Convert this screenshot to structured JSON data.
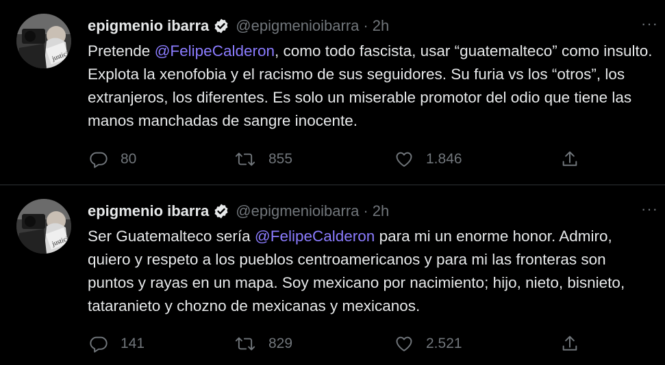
{
  "tweets": [
    {
      "author_name": "epigmenio ibarra",
      "author_handle": "@epigmenioibarra",
      "time": "2h",
      "text_before": "Pretende ",
      "mention": "@FelipeCalderon",
      "text_after": ", como todo fascista, usar “guatemalteco” como insulto. Explota la xenofobia y el racismo de sus seguidores. Su furia vs los “otros”, los extranjeros, los diferentes. Es solo un miserable promotor del odio que tiene las manos manchadas de sangre inocente.",
      "replies": "80",
      "retweets": "855",
      "likes": "1.846",
      "avatar_caption": "justicia"
    },
    {
      "author_name": "epigmenio ibarra",
      "author_handle": "@epigmenioibarra",
      "time": "2h",
      "text_before": "Ser Guatemalteco sería ",
      "mention": "@FelipeCalderon",
      "text_after": " para mi un enorme honor. Admiro, quiero y respeto a los pueblos centroamericanos y para mi las fronteras son puntos y rayas en un mapa. Soy mexicano por nacimiento; hijo, nieto, bisnieto, tataranieto y chozno de mexicanas y mexicanos.",
      "replies": "141",
      "retweets": "829",
      "likes": "2.521",
      "avatar_caption": "justicia"
    }
  ],
  "separator": "·",
  "more_label": "···",
  "icons": {
    "verified": "verified-badge-icon",
    "reply": "reply-icon",
    "retweet": "retweet-icon",
    "like": "heart-icon",
    "share": "share-icon"
  },
  "colors": {
    "background": "#000000",
    "text": "#e7e9ea",
    "secondary": "#71767b",
    "mention": "#8b7cff",
    "divider": "#2f3336"
  }
}
